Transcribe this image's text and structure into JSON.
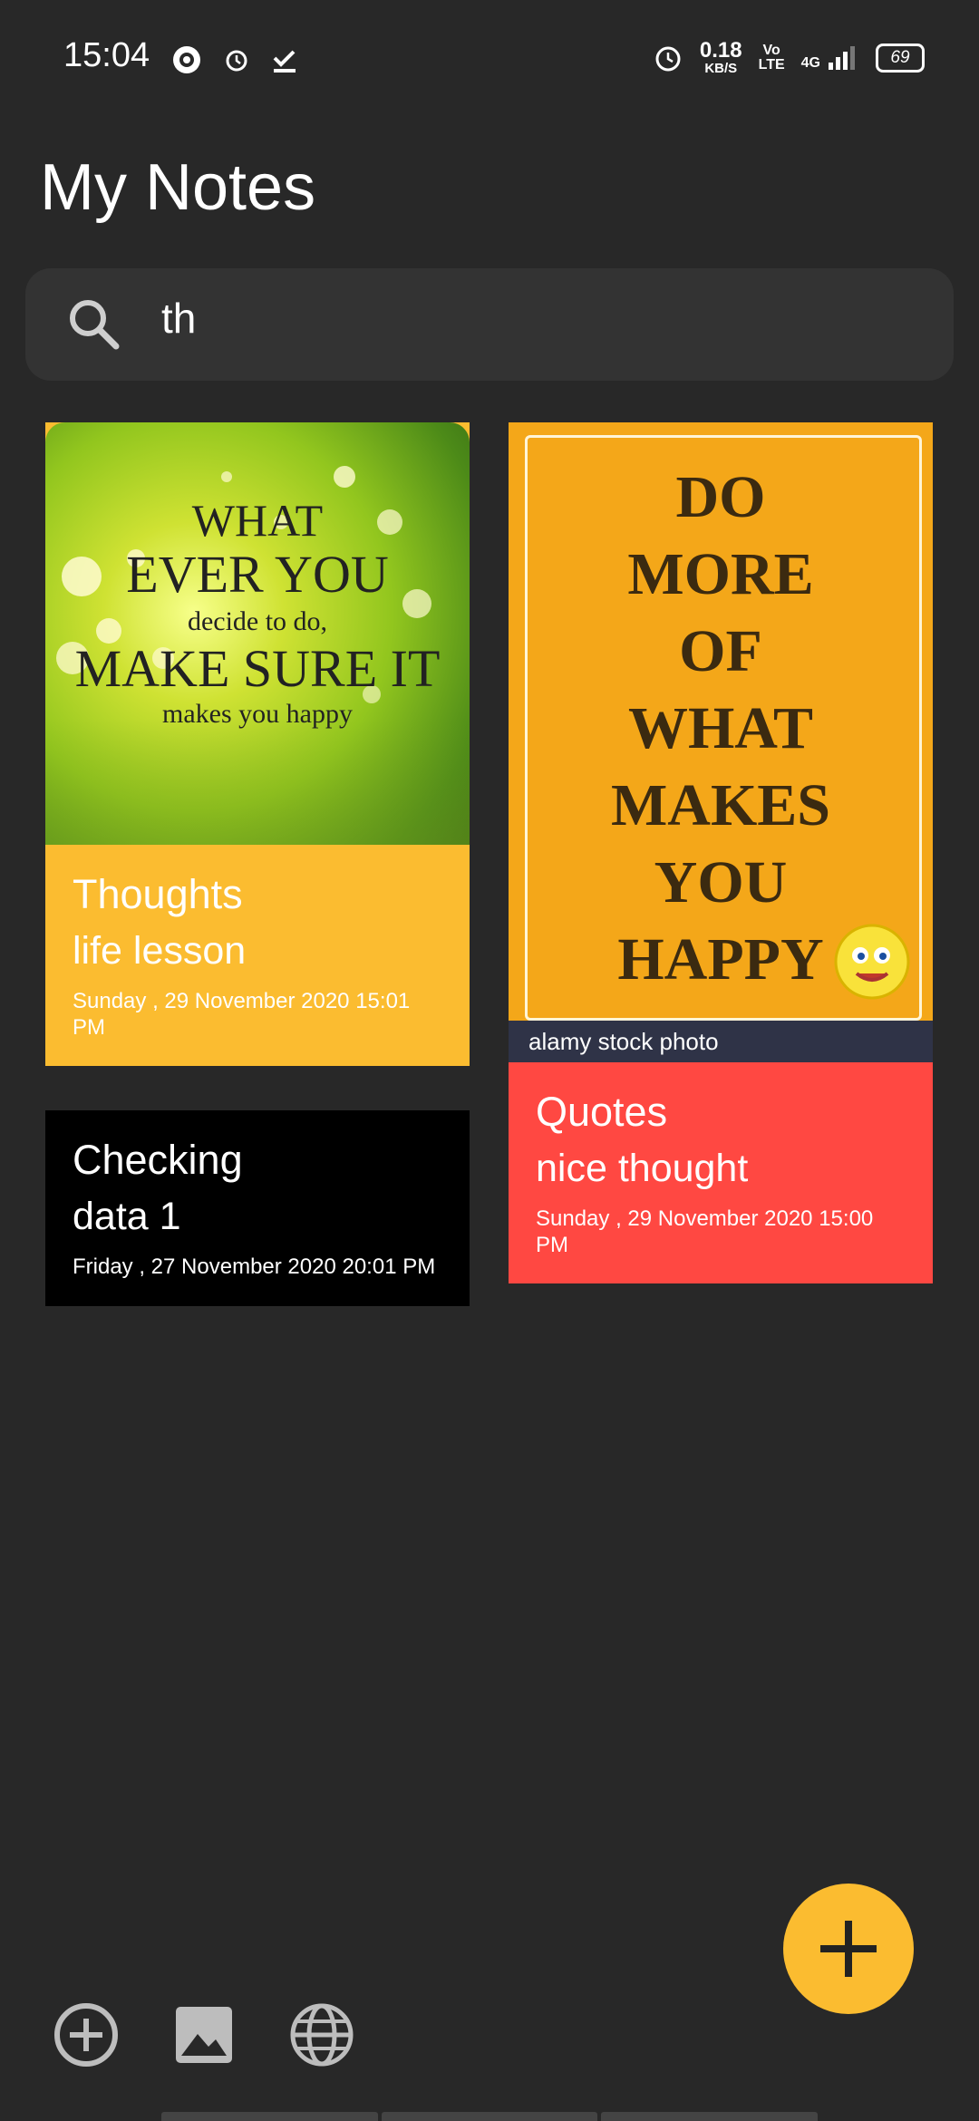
{
  "status_bar": {
    "time": "15:04",
    "net_speed_value": "0.18",
    "net_speed_unit": "KB/S",
    "volte_top": "Vo",
    "volte_bottom": "LTE",
    "network": "4G",
    "battery": "69"
  },
  "header": {
    "title": "My Notes"
  },
  "search": {
    "value": "th",
    "icon": "search-icon"
  },
  "notes": [
    {
      "title": "Thoughts",
      "subtitle": "life lesson",
      "date": "Sunday , 29 November 2020 15:01 PM",
      "color": "#fbbc30",
      "image_text": [
        "WHAT",
        "EVER YOU",
        "decide to do,",
        "MAKE SURE IT",
        "makes you happy"
      ]
    },
    {
      "title": "Checking",
      "subtitle": "data 1",
      "date": "Friday , 27 November 2020 20:01 PM",
      "color": "#000000"
    },
    {
      "title": "Quotes",
      "subtitle": "nice thought",
      "date": "Sunday , 29 November 2020 15:00 PM",
      "color": "#ff4842",
      "image_text": [
        "DO",
        "MORE",
        "OF",
        "WHAT",
        "MAKES",
        "YOU",
        "HAPPY"
      ],
      "watermark": "alamy stock photo"
    }
  ],
  "fab": {
    "icon": "plus-icon",
    "color": "#fbbc30"
  },
  "bottom_bar": {
    "icons": [
      "add-circle-icon",
      "image-icon",
      "globe-icon"
    ]
  }
}
